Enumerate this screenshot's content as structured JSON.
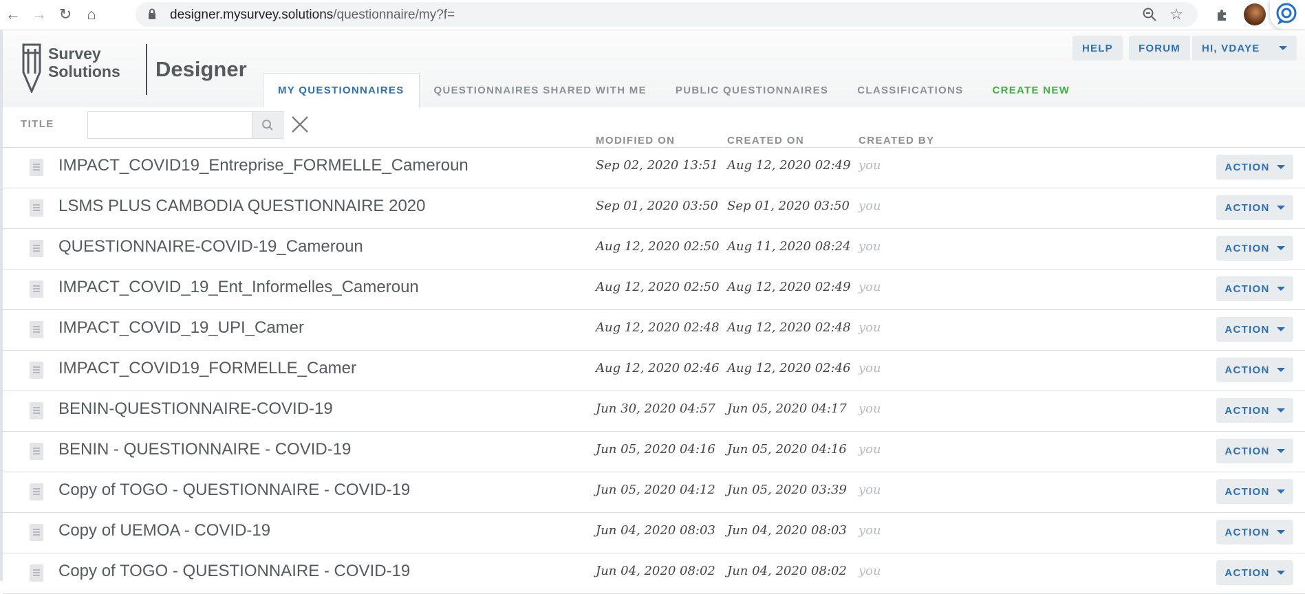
{
  "browser": {
    "url_host": "designer.mysurvey.solutions",
    "url_path": "/questionnaire/my?f="
  },
  "logo": {
    "line1": "Survey",
    "line2": "Solutions",
    "product": "Designer"
  },
  "nav": {
    "help": "HELP",
    "forum": "FORUM",
    "user": "HI, VDAYE"
  },
  "tabs": [
    {
      "label": "MY QUESTIONNAIRES"
    },
    {
      "label": "QUESTIONNAIRES SHARED WITH ME"
    },
    {
      "label": "PUBLIC QUESTIONNAIRES"
    },
    {
      "label": "CLASSIFICATIONS"
    },
    {
      "label": "CREATE NEW"
    }
  ],
  "filter": {
    "title_label": "TITLE",
    "search_value": ""
  },
  "columns": {
    "modified": "MODIFIED ON",
    "created": "CREATED ON",
    "created_by": "CREATED BY"
  },
  "rows": [
    {
      "title": "IMPACT_COVID19_Entreprise_FORMELLE_Cameroun",
      "modified": "Sep 02, 2020 13:51",
      "created": "Aug 12, 2020 02:49",
      "by": "you",
      "action": "ACTION"
    },
    {
      "title": "LSMS PLUS CAMBODIA QUESTIONNAIRE 2020",
      "modified": "Sep 01, 2020 03:50",
      "created": "Sep 01, 2020 03:50",
      "by": "you",
      "action": "ACTION"
    },
    {
      "title": "QUESTIONNAIRE-COVID-19_Cameroun",
      "modified": "Aug 12, 2020 02:50",
      "created": "Aug 11, 2020 08:24",
      "by": "you",
      "action": "ACTION"
    },
    {
      "title": "IMPACT_COVID_19_Ent_Informelles_Cameroun",
      "modified": "Aug 12, 2020 02:50",
      "created": "Aug 12, 2020 02:49",
      "by": "you",
      "action": "ACTION"
    },
    {
      "title": "IMPACT_COVID_19_UPI_Camer",
      "modified": "Aug 12, 2020 02:48",
      "created": "Aug 12, 2020 02:48",
      "by": "you",
      "action": "ACTION"
    },
    {
      "title": "IMPACT_COVID19_FORMELLE_Camer",
      "modified": "Aug 12, 2020 02:46",
      "created": "Aug 12, 2020 02:46",
      "by": "you",
      "action": "ACTION"
    },
    {
      "title": "BENIN-QUESTIONNAIRE-COVID-19",
      "modified": "Jun 30, 2020 04:57",
      "created": "Jun 05, 2020 04:17",
      "by": "you",
      "action": "ACTION"
    },
    {
      "title": "BENIN - QUESTIONNAIRE - COVID-19",
      "modified": "Jun 05, 2020 04:16",
      "created": "Jun 05, 2020 04:16",
      "by": "you",
      "action": "ACTION"
    },
    {
      "title": "Copy of TOGO - QUESTIONNAIRE - COVID-19",
      "modified": "Jun 05, 2020 04:12",
      "created": "Jun 05, 2020 03:39",
      "by": "you",
      "action": "ACTION"
    },
    {
      "title": "Copy of UEMOA - COVID-19",
      "modified": "Jun 04, 2020 08:03",
      "created": "Jun 04, 2020 08:03",
      "by": "you",
      "action": "ACTION"
    },
    {
      "title": "Copy of TOGO - QUESTIONNAIRE - COVID-19",
      "modified": "Jun 04, 2020 08:02",
      "created": "Jun 04, 2020 08:02",
      "by": "you",
      "action": "ACTION"
    }
  ],
  "colors": {
    "accent": "#2d6fb3",
    "create": "#3db03d",
    "muted": "#8a9096"
  }
}
